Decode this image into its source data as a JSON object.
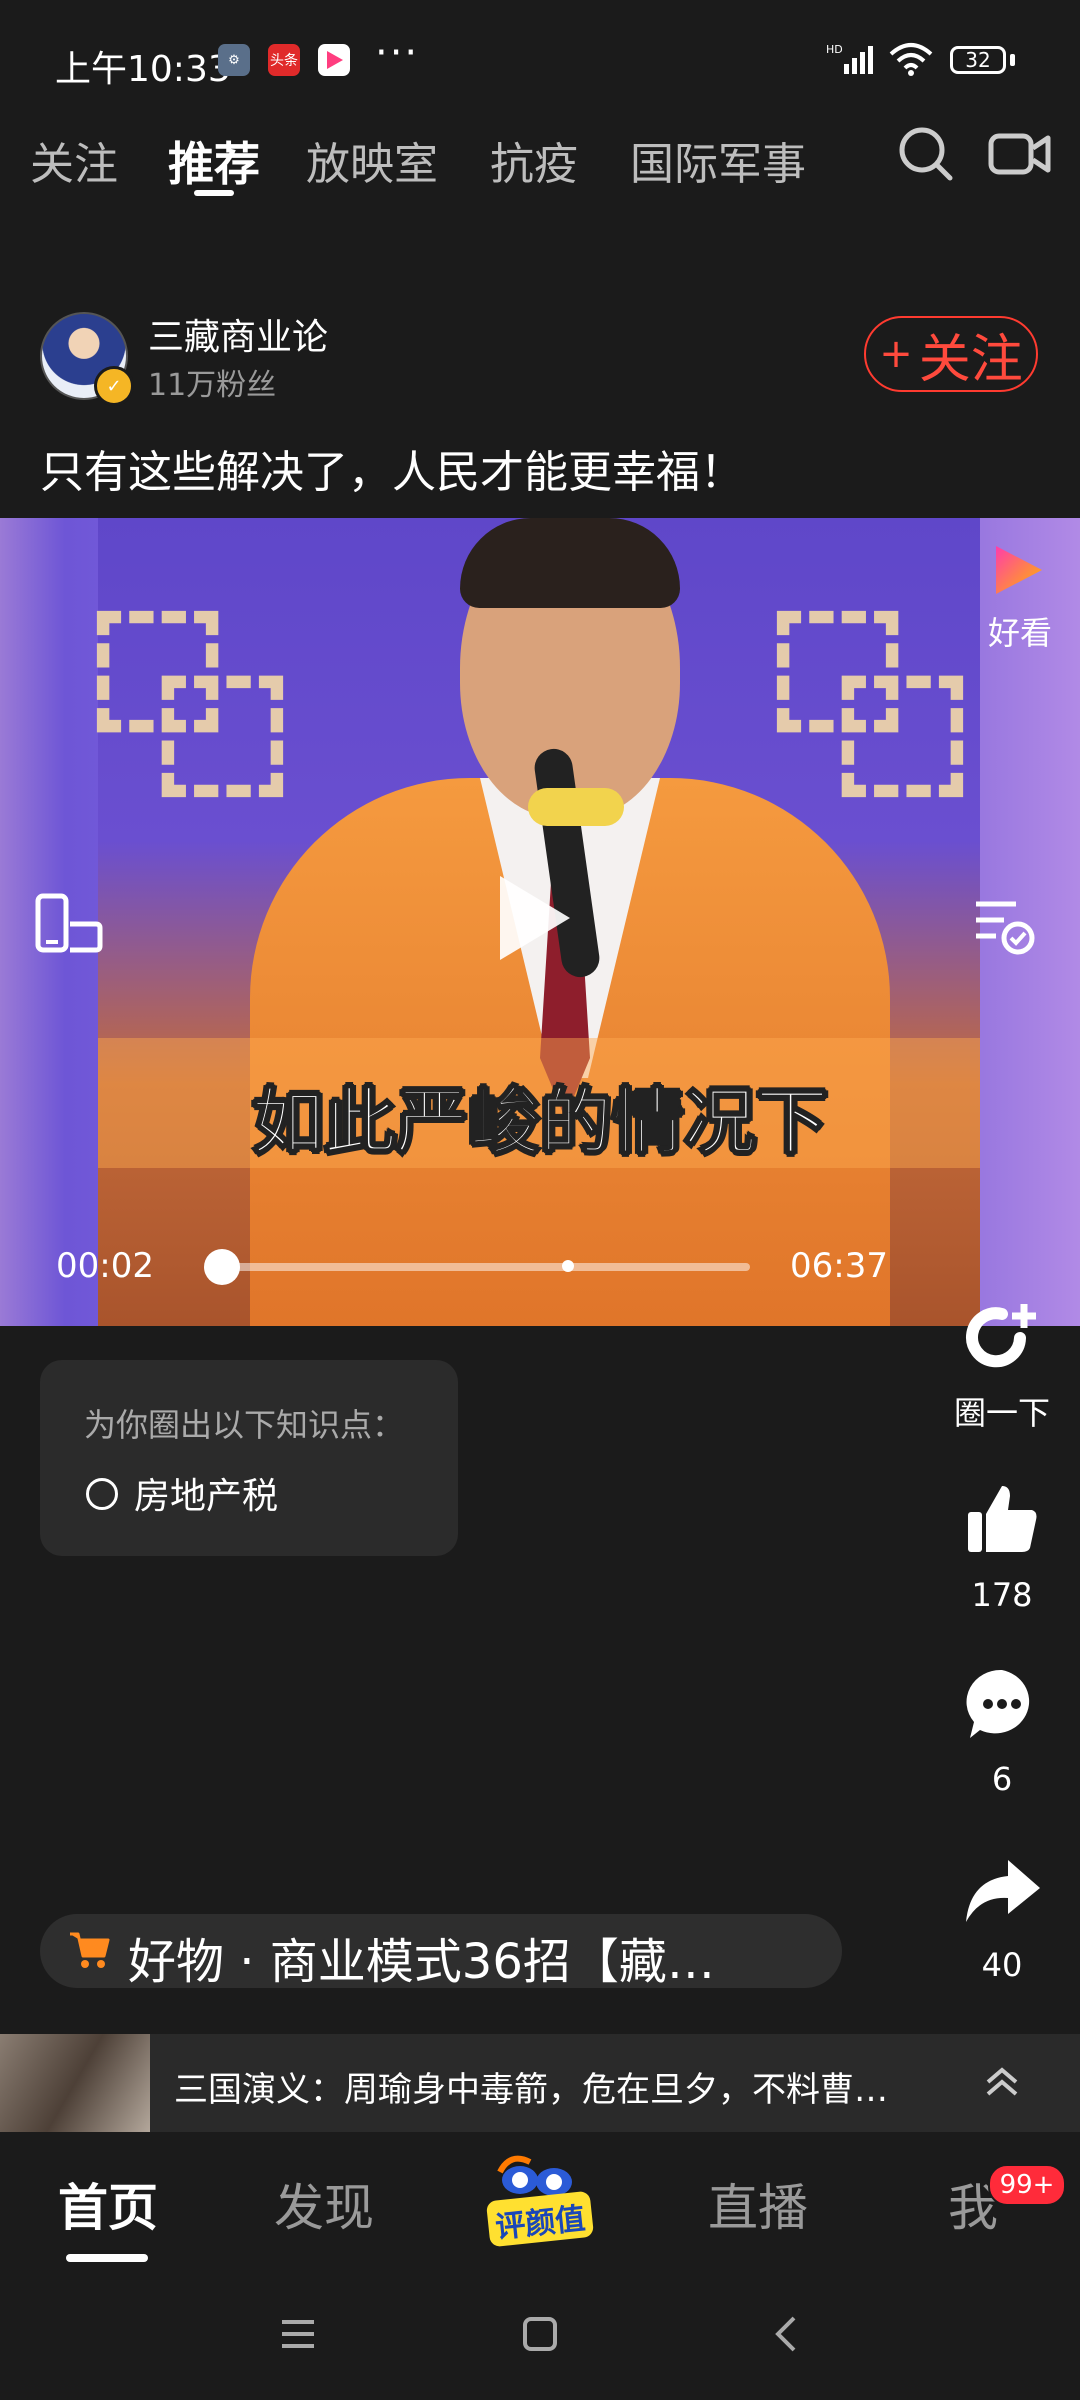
{
  "status_bar": {
    "time": "上午10:33",
    "app_icons": [
      "gear-icon",
      "头条",
      "play-icon"
    ],
    "more": "···",
    "network": "HD",
    "battery": "32"
  },
  "tabs": [
    "关注",
    "推荐",
    "放映室",
    "抗疫",
    "国际军事"
  ],
  "active_tab": "推荐",
  "author": {
    "name": "三藏商业论",
    "fans": "11万粉丝",
    "follow_label": "关注",
    "follow_plus": "+"
  },
  "video": {
    "title": "只有这些解决了，人民才能更幸福！",
    "subtitle": "如此严峻的情况下",
    "current_time": "00:02",
    "total_time": "06:37",
    "progress": 0.005,
    "brand_label": "好看"
  },
  "knowledge": {
    "title": "为你圈出以下知识点：",
    "items": [
      "房地产税"
    ]
  },
  "actions": {
    "circle_label": "圈一下",
    "likes": "178",
    "comments": "6",
    "shares": "40"
  },
  "product": {
    "text": "好物  ·  商业模式36招【藏…"
  },
  "related": {
    "text": "三国演义：周瑜身中毒箭，危在旦夕，不料曹…"
  },
  "bottom_nav": {
    "items": [
      "首页",
      "发现",
      "直播",
      "我"
    ],
    "active": "首页",
    "center_logo": "评颜值",
    "badge": "99+"
  },
  "colors": {
    "background": "#1b1b1b",
    "follow_red": "#ff4a3d",
    "badge_red": "#ff2b3a",
    "cart_orange": "#ff8a1f"
  }
}
